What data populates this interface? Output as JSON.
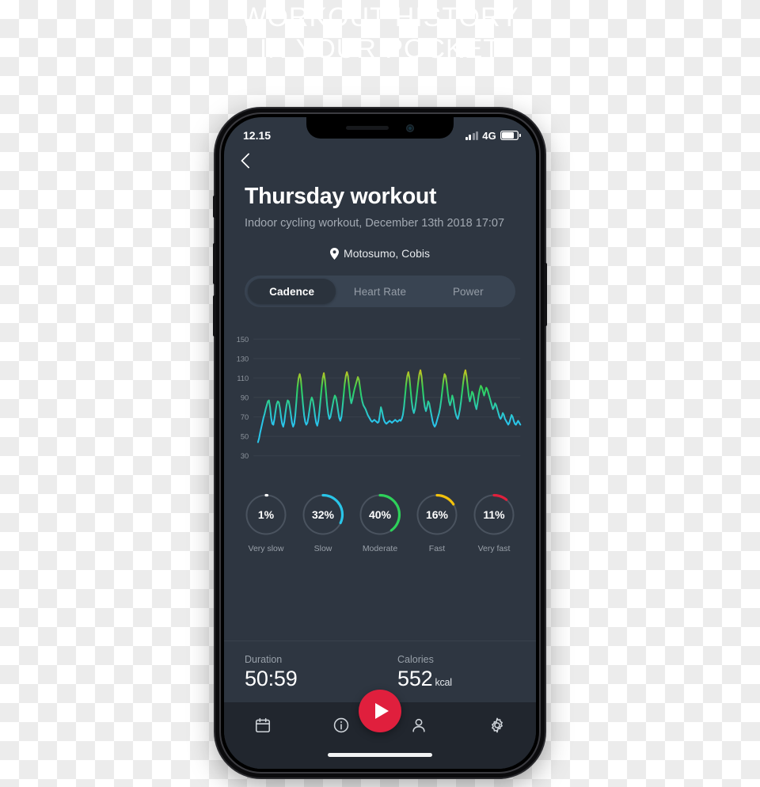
{
  "watermark": {
    "line1": "WORKOUT HISTORY",
    "line2": "IN YOUR POCKET"
  },
  "status_bar": {
    "time": "12.15",
    "network": "4G",
    "signal_icon": "signal-bars-icon",
    "battery_icon": "battery-icon"
  },
  "nav": {
    "back_icon": "chevron-left-icon"
  },
  "header": {
    "title": "Thursday workout",
    "subtitle": "Indoor cycling workout, December 13th 2018 17:07",
    "location": "Motosumo, Cobis",
    "location_icon": "map-pin-icon"
  },
  "tabs": [
    {
      "label": "Cadence",
      "active": true
    },
    {
      "label": "Heart Rate",
      "active": false
    },
    {
      "label": "Power",
      "active": false
    }
  ],
  "chart_data": {
    "type": "line",
    "title": "Cadence",
    "xlabel": "",
    "ylabel": "",
    "ylim": [
      20,
      160
    ],
    "yticks": [
      150,
      130,
      110,
      90,
      70,
      50,
      30
    ],
    "grid": true,
    "legend": false,
    "color_scale": [
      {
        "stop": "very_slow",
        "color": "#ffffff"
      },
      {
        "stop": "slow",
        "color": "#29c5e8"
      },
      {
        "stop": "moderate",
        "color": "#2ed15a"
      },
      {
        "stop": "fast",
        "color": "#f2c10d"
      },
      {
        "stop": "very_fast",
        "color": "#e0203c"
      }
    ],
    "series": [
      {
        "name": "Cadence (rpm)",
        "values": [
          44,
          48,
          54,
          59,
          64,
          69,
          73,
          78,
          82,
          86,
          87,
          80,
          69,
          63,
          62,
          68,
          76,
          83,
          86,
          85,
          79,
          70,
          63,
          60,
          65,
          74,
          82,
          87,
          86,
          80,
          72,
          64,
          60,
          63,
          72,
          86,
          101,
          110,
          114,
          109,
          96,
          83,
          72,
          65,
          62,
          64,
          70,
          78,
          86,
          90,
          87,
          80,
          71,
          64,
          61,
          66,
          76,
          88,
          100,
          110,
          115,
          108,
          95,
          82,
          73,
          68,
          70,
          76,
          82,
          88,
          92,
          90,
          84,
          76,
          69,
          66,
          70,
          80,
          92,
          104,
          112,
          116,
          112,
          101,
          90,
          84,
          88,
          94,
          99,
          103,
          107,
          111,
          108,
          100,
          92,
          86,
          82,
          80,
          78,
          75,
          72,
          70,
          68,
          66,
          65,
          66,
          67,
          66,
          65,
          64,
          65,
          72,
          80,
          76,
          70,
          66,
          64,
          63,
          64,
          65,
          66,
          65,
          64,
          65,
          66,
          67,
          66,
          65,
          66,
          67,
          66,
          68,
          72,
          80,
          92,
          104,
          112,
          116,
          110,
          98,
          86,
          78,
          74,
          78,
          86,
          96,
          106,
          114,
          118,
          112,
          100,
          88,
          80,
          76,
          80,
          86,
          84,
          78,
          72,
          66,
          62,
          60,
          62,
          66,
          70,
          74,
          80,
          88,
          98,
          108,
          114,
          112,
          104,
          94,
          86,
          82,
          86,
          92,
          88,
          80,
          74,
          70,
          68,
          72,
          78,
          86,
          96,
          106,
          114,
          118,
          112,
          102,
          92,
          86,
          90,
          96,
          94,
          88,
          82,
          78,
          84,
          92,
          98,
          102,
          100,
          96,
          92,
          96,
          100,
          98,
          94,
          90,
          86,
          82,
          78,
          80,
          84,
          82,
          78,
          74,
          70,
          68,
          70,
          74,
          72,
          68,
          66,
          64,
          62,
          64,
          68,
          72,
          70,
          66,
          63,
          62,
          64,
          66,
          64,
          62
        ]
      }
    ]
  },
  "gauges": [
    {
      "value": "1%",
      "percent": 1,
      "label": "Very slow",
      "color": "#ffffff"
    },
    {
      "value": "32%",
      "percent": 32,
      "label": "Slow",
      "color": "#29c5e8"
    },
    {
      "value": "40%",
      "percent": 40,
      "label": "Moderate",
      "color": "#2ed15a"
    },
    {
      "value": "16%",
      "percent": 16,
      "label": "Fast",
      "color": "#f2c10d"
    },
    {
      "value": "11%",
      "percent": 11,
      "label": "Very fast",
      "color": "#e0203c"
    }
  ],
  "stats": {
    "duration_label": "Duration",
    "duration_value": "50:59",
    "calories_label": "Calories",
    "calories_value": "552",
    "calories_unit": "kcal"
  },
  "bottom_nav": [
    {
      "icon": "calendar-icon"
    },
    {
      "icon": "info-icon"
    },
    {
      "icon": "play-icon",
      "accent": "#e01f3d"
    },
    {
      "icon": "person-icon"
    },
    {
      "icon": "gear-icon"
    }
  ]
}
